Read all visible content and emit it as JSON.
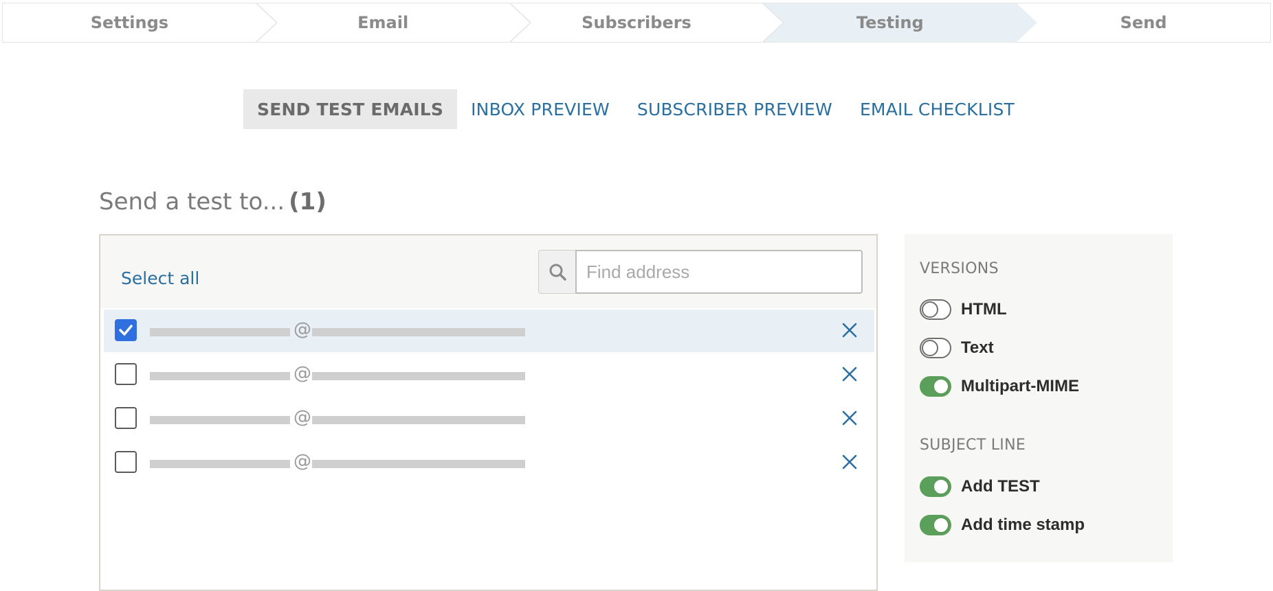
{
  "stepper": {
    "steps": [
      {
        "label": "Settings",
        "active": false
      },
      {
        "label": "Email",
        "active": false
      },
      {
        "label": "Subscribers",
        "active": false
      },
      {
        "label": "Testing",
        "active": true
      },
      {
        "label": "Send",
        "active": false
      }
    ]
  },
  "tabs": {
    "items": [
      {
        "label": "SEND TEST EMAILS",
        "active": true
      },
      {
        "label": "INBOX PREVIEW",
        "active": false
      },
      {
        "label": "SUBSCRIBER PREVIEW",
        "active": false
      },
      {
        "label": "EMAIL CHECKLIST",
        "active": false
      }
    ]
  },
  "recipients": {
    "heading": "Send a test to...",
    "count": "(1)",
    "select_all": "Select all",
    "search_placeholder": "Find address",
    "at_symbol": "@",
    "rows": [
      {
        "checked": true
      },
      {
        "checked": false
      },
      {
        "checked": false
      },
      {
        "checked": false
      }
    ]
  },
  "options": {
    "versions_heading": "VERSIONS",
    "versions": [
      {
        "label": "HTML",
        "on": false
      },
      {
        "label": "Text",
        "on": false
      },
      {
        "label": "Multipart-MIME",
        "on": true
      }
    ],
    "subject_heading": "SUBJECT LINE",
    "subject": [
      {
        "label": "Add TEST",
        "on": true
      },
      {
        "label": "Add time stamp",
        "on": true
      }
    ]
  },
  "colors": {
    "accent_blue": "#2a6fa0",
    "checkbox_blue": "#2f6fe0",
    "toggle_on": "#5aa05a",
    "active_step_bg": "#e8f0f6"
  }
}
